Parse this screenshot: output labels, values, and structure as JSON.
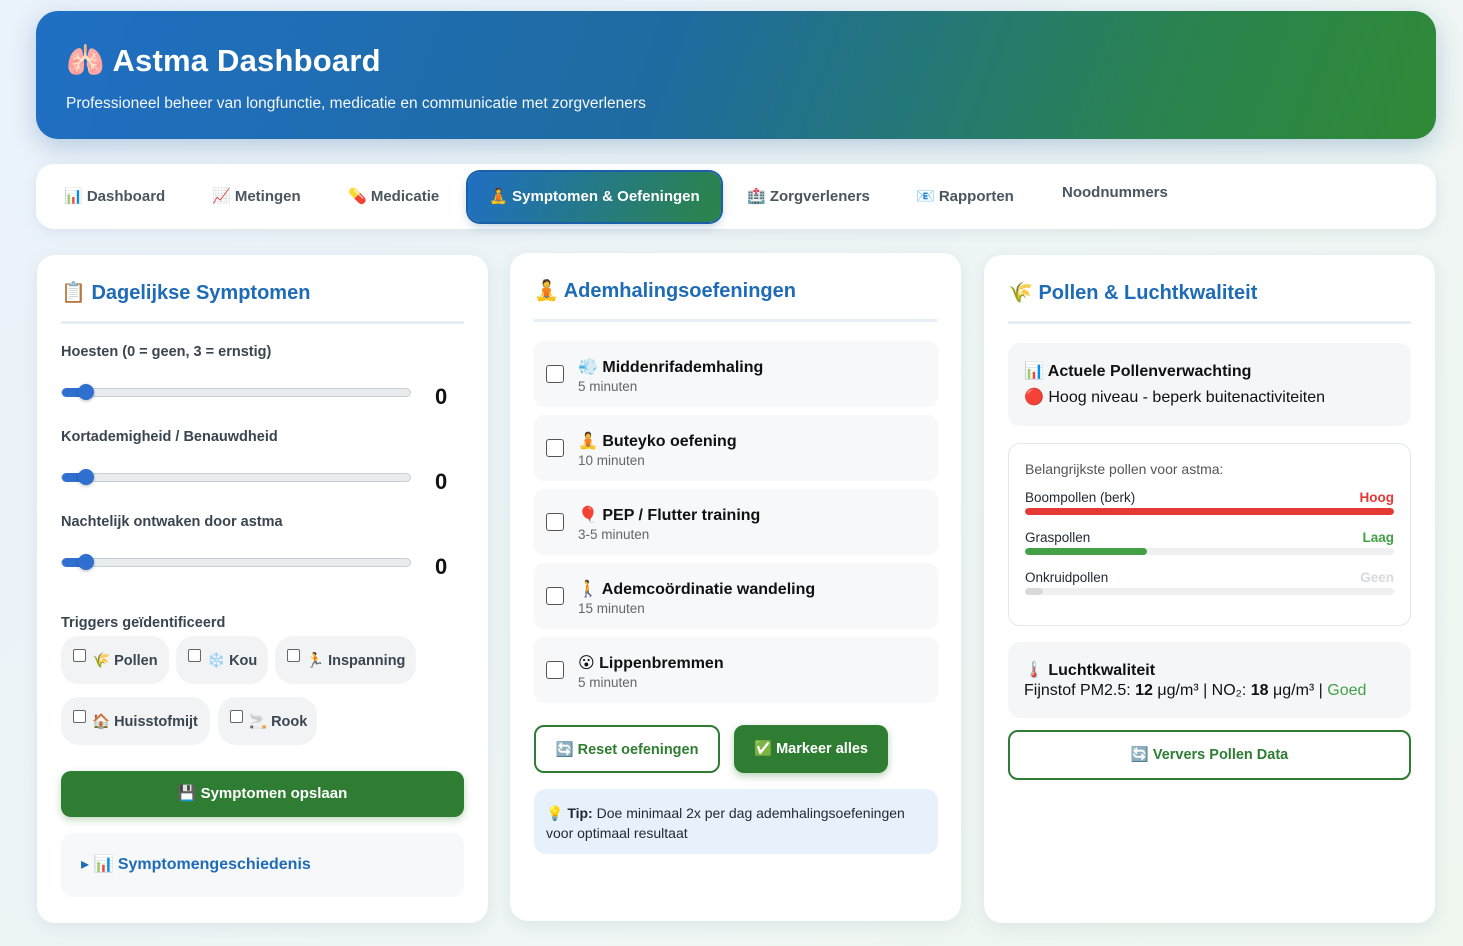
{
  "header": {
    "title": "🫁 Astma Dashboard",
    "subtitle": "Professioneel beheer van longfunctie, medicatie en communicatie met zorgverleners"
  },
  "nav": {
    "tabs": [
      {
        "label": "📊 Dashboard"
      },
      {
        "label": "📈 Metingen"
      },
      {
        "label": "💊 Medicatie"
      },
      {
        "label": "🧘 Symptomen & Oefeningen"
      },
      {
        "label": "🏥 Zorgverleners"
      },
      {
        "label": "📧 Rapporten"
      },
      {
        "label": "Noodnummers"
      }
    ],
    "active_tab": "🧘 Symptomen & Oefeningen"
  },
  "symptoms": {
    "title": "📋 Dagelijkse Symptomen",
    "sliders": [
      {
        "label": "Hoesten (0 = geen, 3 = ernstig)",
        "value": "0",
        "max": 3
      },
      {
        "label": "Kortademigheid / Benauwdheid",
        "value": "0",
        "max": 3
      },
      {
        "label": "Nachtelijk ontwaken door astma",
        "value": "0",
        "max": 3
      }
    ],
    "triggers_label": "Triggers geïdentificeerd",
    "triggers": [
      {
        "label": "🌾 Pollen",
        "checked": false
      },
      {
        "label": "❄️ Kou",
        "checked": false
      },
      {
        "label": "🏃 Inspanning",
        "checked": false
      },
      {
        "label": "🏠 Huisstofmijt",
        "checked": false
      },
      {
        "label": "🚬 Rook",
        "checked": false
      }
    ],
    "save_button": "💾 Symptomen opslaan",
    "history_label": "▸ 📊 Symptomengeschiedenis"
  },
  "exercises": {
    "title": "🧘 Ademhalingsoefeningen",
    "items": [
      {
        "name": "💨 Middenrifademhaling",
        "duration": "5 minuten",
        "checked": false
      },
      {
        "name": "🧘 Buteyko oefening",
        "duration": "10 minuten",
        "checked": false
      },
      {
        "name": "🎈 PEP / Flutter training",
        "duration": "3-5 minuten",
        "checked": false
      },
      {
        "name": "🚶 Ademcoördinatie wandeling",
        "duration": "15 minuten",
        "checked": false
      },
      {
        "name": "😮 Lippenbremmen",
        "duration": "5 minuten",
        "checked": false
      }
    ],
    "reset_button": "🔄 Reset oefeningen",
    "mark_all_button": "✅ Markeer alles",
    "tip_prefix": "💡 Tip:",
    "tip_text": " Doe minimaal 2x per dag ademhalingsoefeningen voor optimaal resultaat"
  },
  "pollen": {
    "title": "🌾 Pollen & Luchtkwaliteit",
    "forecast_title": "📊 Actuele Pollenverwachting",
    "forecast_status": "🔴 Hoog niveau - beperk buitenactiviteiten",
    "list_title": "Belangrijkste pollen voor astma:",
    "list": [
      {
        "name": "Boompollen (berk)",
        "level": "Hoog",
        "fraction": 1.0,
        "color": "#e53935"
      },
      {
        "name": "Graspollen",
        "level": "Laag",
        "fraction": 0.33,
        "color": "#43a047"
      },
      {
        "name": "Onkruidpollen",
        "level": "Geen",
        "fraction": 0.05,
        "color": "#d7dadd"
      }
    ],
    "air_title": "🌡️ Luchtkwaliteit",
    "air_prefix": "Fijnstof PM2.5: ",
    "pm25": "12",
    "pm25_unit": " μg/m³ | NO₂: ",
    "no2": "18",
    "no2_unit": " μg/m³ | ",
    "air_status": "Goed",
    "refresh_button": "🔄 Ververs Pollen Data"
  },
  "colors": {
    "accent_blue": "#1e6bb8",
    "accent_green": "#2e7d32",
    "danger": "#e53935",
    "good": "#43a047"
  }
}
